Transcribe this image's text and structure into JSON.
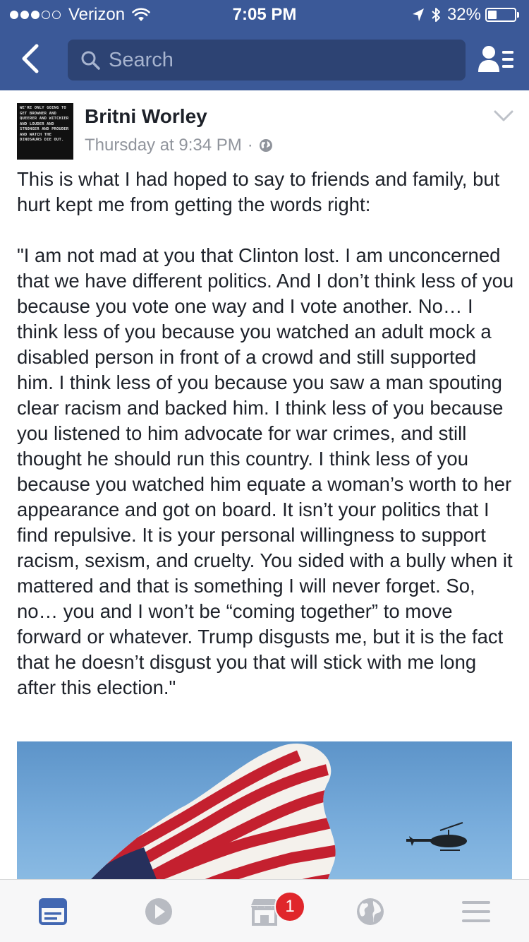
{
  "status_bar": {
    "carrier": "Verizon",
    "time": "7:05 PM",
    "battery": "32%",
    "battery_level": 0.32,
    "signal_bars": 3
  },
  "nav": {
    "search_placeholder": "Search",
    "color": "#3b5998"
  },
  "post": {
    "author": "Britni Worley",
    "timestamp": "Thursday at 9:34 PM",
    "separator": "·",
    "privacy_icon": "globe-icon",
    "avatar_text": "We're only going to get browner and queerer and witchier and louder and stronger and prouder and watch the dinosaurs die out.",
    "text": "This is what I had hoped to say to friends and family, but hurt kept me from getting the words right:\n\n\"I am not mad at you that Clinton lost. I am unconcerned that we have different politics. And I don’t think less of you because you vote one way and I vote another. No… I think less of you because you watched an adult mock a disabled person in front of a crowd and still supported him. I think less of you because you saw a man spouting clear racism and backed him. I think less of you because you listened to him advocate for war crimes, and still thought he should run this country. I think less of you because you watched him equate a woman’s worth to her appearance and got on board. It isn’t your politics that I find repulsive. It is your personal willingness to support racism, sexism, and cruelty. You sided with a bully when it mattered and that is something I will never forget. So, no… you and I won’t be “coming together” to move forward or whatever. Trump disgusts me, but it is the fact that he doesn’t disgust you that will stick with me long after this election.\""
  },
  "tab_bar": {
    "tabs": [
      "news-feed-icon",
      "video-icon",
      "marketplace-icon",
      "notifications-globe-icon",
      "menu-icon"
    ],
    "active": "news-feed-icon",
    "marketplace_badge": "1"
  }
}
